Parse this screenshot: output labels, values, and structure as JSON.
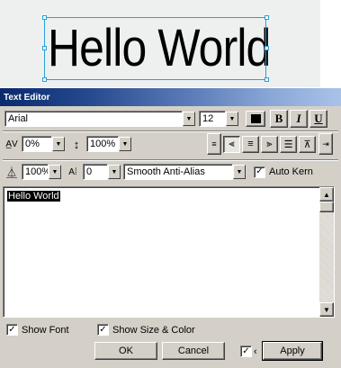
{
  "canvas": {
    "text": "Hello World"
  },
  "dialog": {
    "title": "Text Editor"
  },
  "font": {
    "name": "Arial",
    "size": "12",
    "color": "#000000",
    "bold": "B",
    "italic": "I",
    "underline": "U"
  },
  "spacing": {
    "kerning": "0%",
    "leading": "100%"
  },
  "scale": {
    "horizontal": "100%",
    "baseline": "0",
    "antialias": "Smooth Anti-Alias",
    "autokern": "Auto Kern"
  },
  "editor": {
    "content": "Hello World"
  },
  "options": {
    "show_font": "Show Font",
    "show_size_color": "Show Size & Color"
  },
  "footer": {
    "ok": "OK",
    "cancel": "Cancel",
    "preview_check": "✓",
    "apply": "Apply"
  }
}
